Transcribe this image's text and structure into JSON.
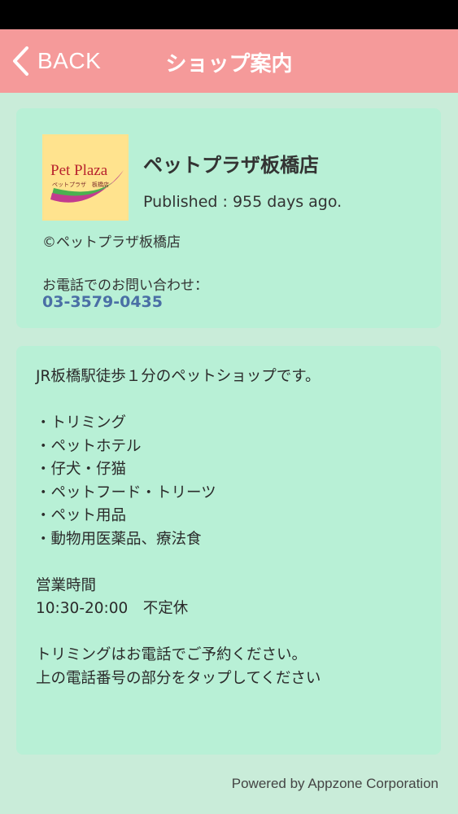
{
  "nav": {
    "back_label": "BACK",
    "title": "ショップ案内"
  },
  "shop": {
    "logo_text": "Pet Plaza",
    "logo_subtext": "ペットプラザ 板橋店",
    "name": "ペットプラザ板橋店",
    "published": "Published : 955 days ago.",
    "copyright": "©ペットプラザ板橋店",
    "phone_label": "お電話でのお問い合わせ：",
    "phone_number": "03-3579-0435"
  },
  "description": {
    "lines": [
      "JR板橋駅徒歩１分のペットショップです。",
      "",
      "・トリミング",
      "・ペットホテル",
      "・仔犬・仔猫",
      "・ペットフード・トリーツ",
      "・ペット用品",
      "・動物用医薬品、療法食",
      "",
      "営業時間",
      "10:30-20:00　不定休",
      "",
      "トリミングはお電話でご予約ください。",
      "上の電話番号の部分をタップしてください"
    ]
  },
  "footer": {
    "powered_by": "Powered by Appzone Corporation"
  },
  "colors": {
    "navbar": "#f59a9a",
    "background": "#c9ecd9",
    "card": "#b8f0d6",
    "logo_bg": "#ffe38e",
    "phone_link": "#4a6fa5"
  }
}
